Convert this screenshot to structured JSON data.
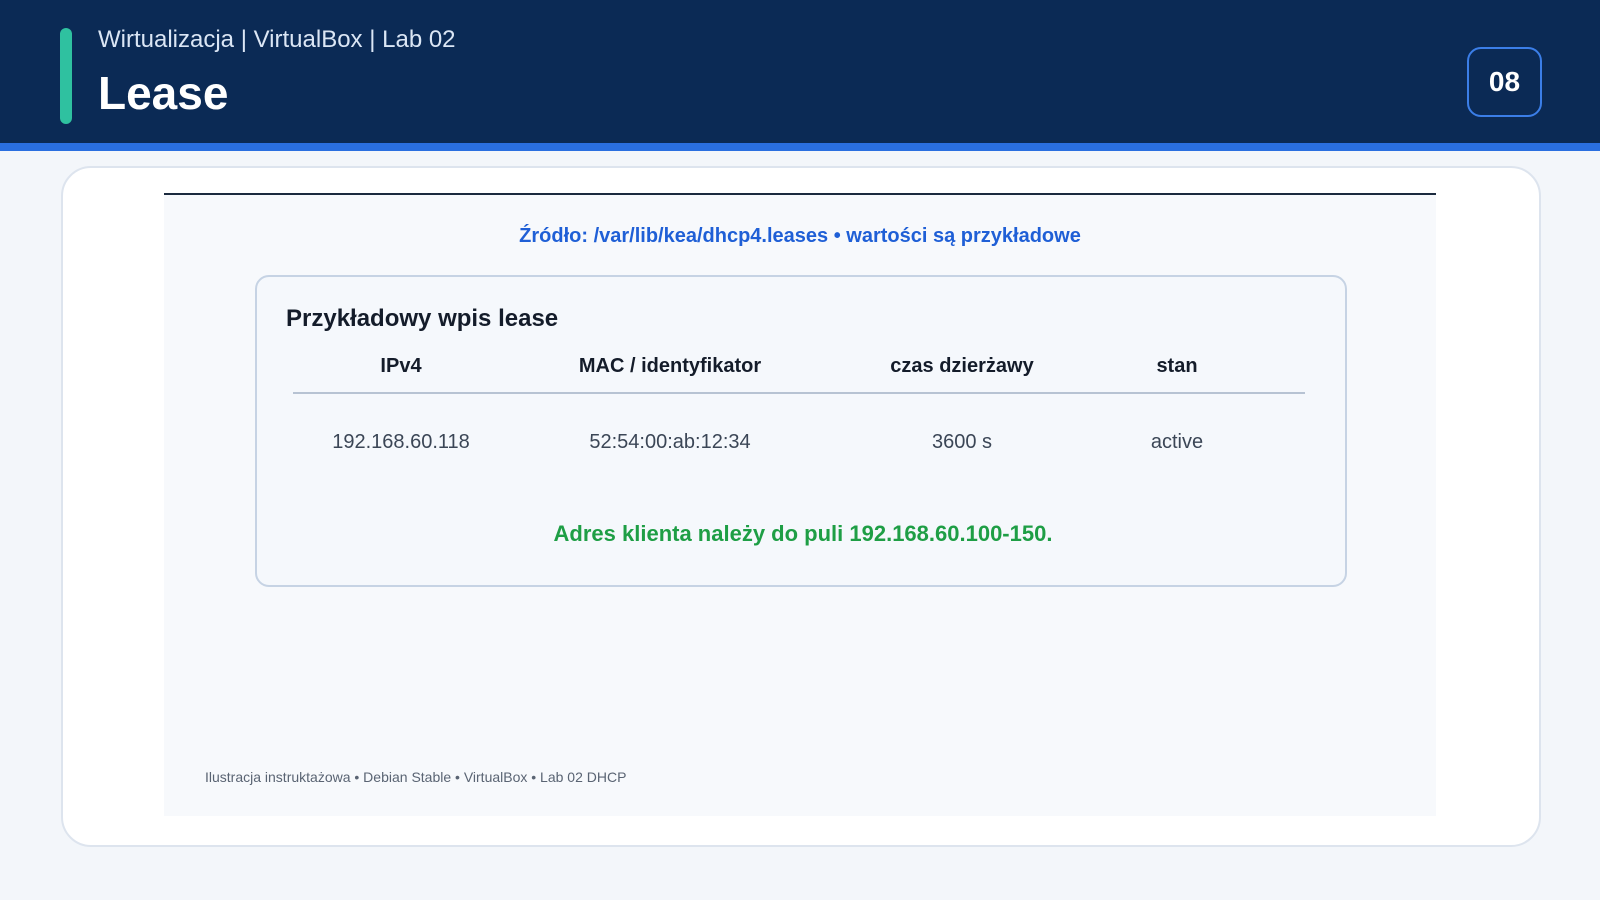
{
  "header": {
    "subtitle": "Wirtualizacja | VirtualBox | Lab 02",
    "title": "Lease",
    "page_number": "08"
  },
  "colors": {
    "header_bg": "#0b2a55",
    "accent": "#2fc1a0",
    "rule_blue": "#2a6fe0",
    "source_text": "#1f5fd6",
    "note_green": "#1e9e45"
  },
  "content": {
    "source_line": "Źródło: /var/lib/kea/dhcp4.leases • wartości są przykładowe",
    "panel": {
      "title": "Przykładowy wpis lease",
      "columns": [
        "IPv4",
        "MAC / identyfikator",
        "czas dzierżawy",
        "stan"
      ],
      "rows": [
        [
          "192.168.60.118",
          "52:54:00:ab:12:34",
          "3600 s",
          "active"
        ]
      ],
      "note": "Adres klienta należy do puli 192.168.60.100-150."
    },
    "footer": "Ilustracja instruktażowa • Debian Stable • VirtualBox • Lab 02 DHCP"
  }
}
